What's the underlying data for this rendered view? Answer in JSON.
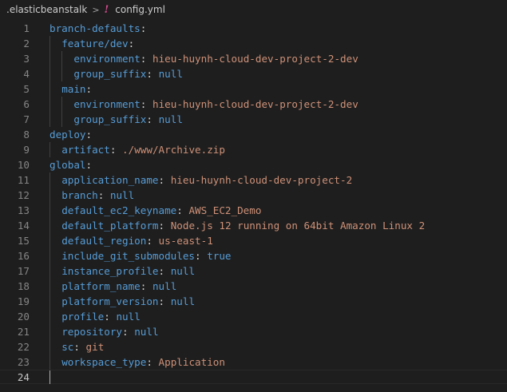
{
  "breadcrumb": {
    "folder": ".elasticbeanstalk",
    "separator": ">",
    "file_icon": "!",
    "file": "config.yml"
  },
  "lines": [
    {
      "n": "1",
      "indent": 0,
      "key": "branch-defaults",
      "value": ""
    },
    {
      "n": "2",
      "indent": 1,
      "key": "feature/dev",
      "value": ""
    },
    {
      "n": "3",
      "indent": 2,
      "key": "environment",
      "value": "hieu-huynh-cloud-dev-project-2-dev"
    },
    {
      "n": "4",
      "indent": 2,
      "key": "group_suffix",
      "value": "null"
    },
    {
      "n": "5",
      "indent": 1,
      "key": "main",
      "value": ""
    },
    {
      "n": "6",
      "indent": 2,
      "key": "environment",
      "value": "hieu-huynh-cloud-dev-project-2-dev"
    },
    {
      "n": "7",
      "indent": 2,
      "key": "group_suffix",
      "value": "null"
    },
    {
      "n": "8",
      "indent": 0,
      "key": "deploy",
      "value": ""
    },
    {
      "n": "9",
      "indent": 1,
      "key": "artifact",
      "value": "./www/Archive.zip"
    },
    {
      "n": "10",
      "indent": 0,
      "key": "global",
      "value": ""
    },
    {
      "n": "11",
      "indent": 1,
      "key": "application_name",
      "value": "hieu-huynh-cloud-dev-project-2"
    },
    {
      "n": "12",
      "indent": 1,
      "key": "branch",
      "value": "null"
    },
    {
      "n": "13",
      "indent": 1,
      "key": "default_ec2_keyname",
      "value": "AWS_EC2_Demo"
    },
    {
      "n": "14",
      "indent": 1,
      "key": "default_platform",
      "value": "Node.js 12 running on 64bit Amazon Linux 2"
    },
    {
      "n": "15",
      "indent": 1,
      "key": "default_region",
      "value": "us-east-1"
    },
    {
      "n": "16",
      "indent": 1,
      "key": "include_git_submodules",
      "value": "true"
    },
    {
      "n": "17",
      "indent": 1,
      "key": "instance_profile",
      "value": "null"
    },
    {
      "n": "18",
      "indent": 1,
      "key": "platform_name",
      "value": "null"
    },
    {
      "n": "19",
      "indent": 1,
      "key": "platform_version",
      "value": "null"
    },
    {
      "n": "20",
      "indent": 1,
      "key": "profile",
      "value": "null"
    },
    {
      "n": "21",
      "indent": 1,
      "key": "repository",
      "value": "null"
    },
    {
      "n": "22",
      "indent": 1,
      "key": "sc",
      "value": "git"
    },
    {
      "n": "23",
      "indent": 1,
      "key": "workspace_type",
      "value": "Application"
    },
    {
      "n": "24",
      "indent": 0,
      "key": "",
      "value": ""
    }
  ],
  "current_line": "24",
  "colors": {
    "background": "#1e1e1e",
    "key": "#569cd6",
    "punctuation": "#d4d4d4",
    "keyword_value": "#569cd6",
    "string_value": "#ce9178",
    "line_number": "#858585"
  }
}
